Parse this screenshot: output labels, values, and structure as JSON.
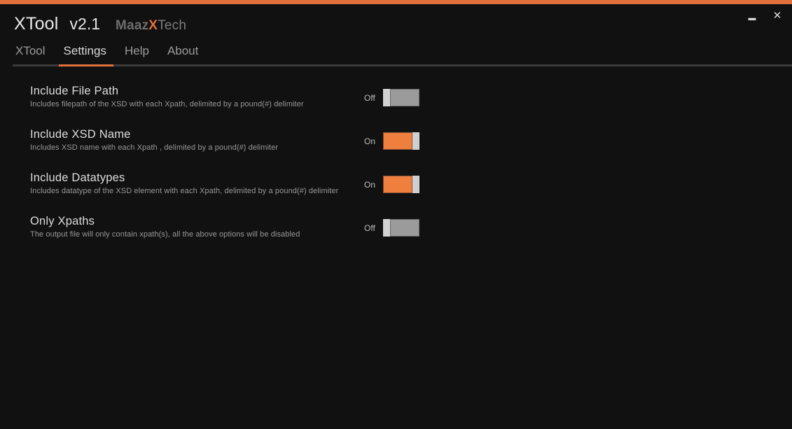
{
  "window": {
    "accent_color": "#e2713c",
    "background_color": "#111111",
    "minimize_label": "▬",
    "close_label": "✕"
  },
  "header": {
    "app_name": "XTool",
    "version": "v2.1",
    "brand": {
      "part1": "Maaz",
      "part2": "X",
      "part3": "Tech"
    }
  },
  "tabs": [
    {
      "label": "XTool",
      "active": false
    },
    {
      "label": "Settings",
      "active": true
    },
    {
      "label": "Help",
      "active": false
    },
    {
      "label": "About",
      "active": false
    }
  ],
  "settings": [
    {
      "label": "Include File Path",
      "description": "Includes filepath of the XSD with each Xpath, delimited by a pound(#) delimiter",
      "state": "Off",
      "on": false
    },
    {
      "label": "Include XSD Name",
      "description": "Includes XSD name with each Xpath , delimited by a pound(#) delimiter",
      "state": "On",
      "on": true
    },
    {
      "label": "Include Datatypes",
      "description": "Includes datatype of the XSD element with each Xpath, delimited by a pound(#) delimiter",
      "state": "On",
      "on": true
    },
    {
      "label": "Only Xpaths",
      "description": "The output file will only contain xpath(s), all the above options will be disabled",
      "state": "Off",
      "on": false
    }
  ]
}
